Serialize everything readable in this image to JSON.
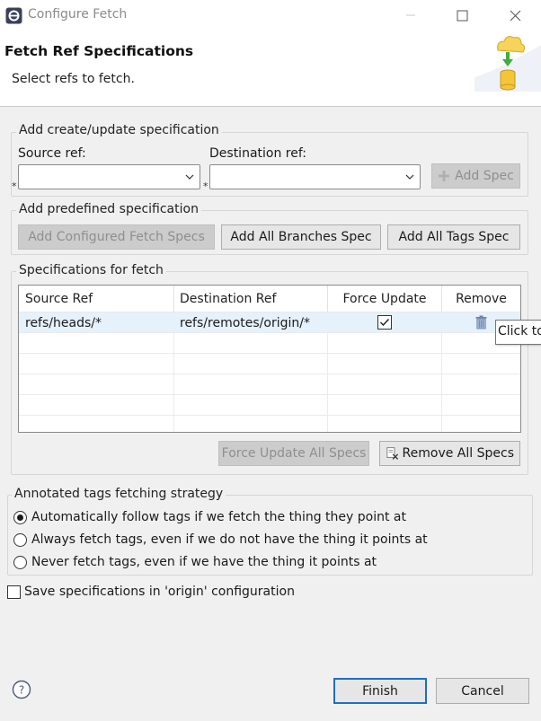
{
  "window": {
    "title": "Configure Fetch"
  },
  "banner": {
    "title": "Fetch Ref Specifications",
    "subtitle": "Select refs to fetch."
  },
  "add_spec": {
    "group_title": "Add create/update specification",
    "source_label": "Source ref:",
    "destination_label": "Destination ref:",
    "source_value": "",
    "destination_value": "",
    "required_marker": "*",
    "add_button": "Add Spec"
  },
  "predefined": {
    "group_title": "Add predefined specification",
    "configured_button": "Add Configured Fetch Specs",
    "branches_button": "Add All Branches Spec",
    "tags_button": "Add All Tags Spec"
  },
  "specs": {
    "group_title": "Specifications for fetch",
    "columns": [
      "Source Ref",
      "Destination Ref",
      "Force Update",
      "Remove"
    ],
    "rows": [
      {
        "source": "refs/heads/*",
        "destination": "refs/remotes/origin/*",
        "force_update": true
      }
    ],
    "tooltip": "Click to",
    "force_all_button": "Force Update All Specs",
    "remove_all_button": "Remove All Specs"
  },
  "tags_strategy": {
    "group_title": "Annotated tags fetching strategy",
    "options": [
      "Automatically follow tags if we fetch the thing they point at",
      "Always fetch tags, even if we do not have the thing it points at",
      "Never fetch tags, even if we have the thing it points at"
    ],
    "selected_index": 0
  },
  "save_config": {
    "label": "Save specifications in 'origin' configuration",
    "checked": false
  },
  "footer": {
    "finish_button": "Finish",
    "cancel_button": "Cancel"
  },
  "icons": {
    "app": "eclipse-icon",
    "minimize": "minimize-icon",
    "maximize": "maximize-icon",
    "close": "close-icon",
    "banner": "fetch-wizard-icon",
    "add": "add-icon",
    "trash": "trash-icon",
    "remove_all": "remove-all-icon",
    "help": "help-icon"
  },
  "colors": {
    "selection": "#e5f1fb",
    "primary_border": "#1a6fc9",
    "background": "#f0f0f0"
  }
}
